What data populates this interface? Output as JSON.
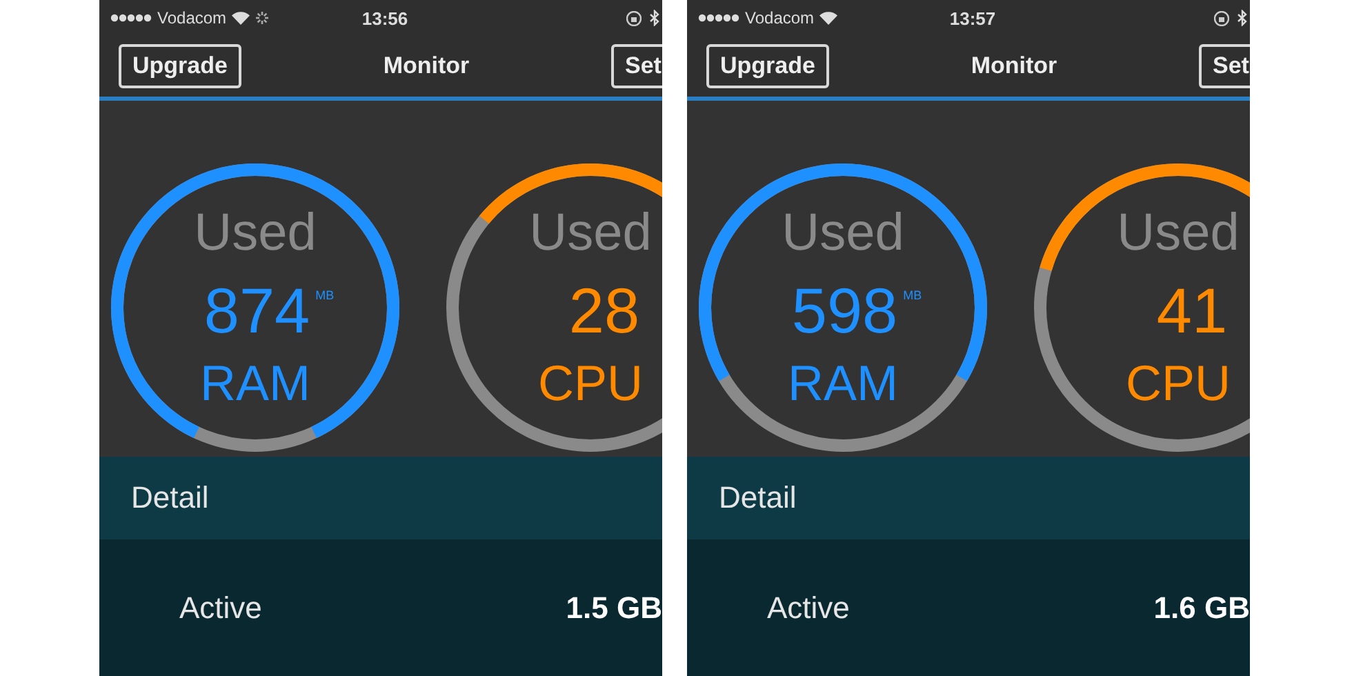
{
  "screens": [
    {
      "status_bar": {
        "carrier": "Vodacom",
        "time": "13:56",
        "activity_indicator": true
      },
      "nav": {
        "left_button": "Upgrade",
        "title": "Monitor",
        "right_button": "Set"
      },
      "gauges": [
        {
          "caption": "Used",
          "value": "874",
          "unit": "MB",
          "label": "RAM",
          "color": "#1e90ff"
        },
        {
          "caption": "Used",
          "value": "28",
          "label": "CPU",
          "color": "#ff8a00"
        }
      ],
      "detail": {
        "title": "Detail",
        "rows": [
          {
            "label": "Active",
            "value": "1.5 GB"
          }
        ]
      }
    },
    {
      "status_bar": {
        "carrier": "Vodacom",
        "time": "13:57",
        "activity_indicator": false
      },
      "nav": {
        "left_button": "Upgrade",
        "title": "Monitor",
        "right_button": "Set"
      },
      "gauges": [
        {
          "caption": "Used",
          "value": "598",
          "unit": "MB",
          "label": "RAM",
          "color": "#1e90ff"
        },
        {
          "caption": "Used",
          "value": "41",
          "label": "CPU",
          "color": "#ff8a00"
        }
      ],
      "detail": {
        "title": "Detail",
        "rows": [
          {
            "label": "Active",
            "value": "1.6 GB"
          }
        ]
      }
    }
  ]
}
